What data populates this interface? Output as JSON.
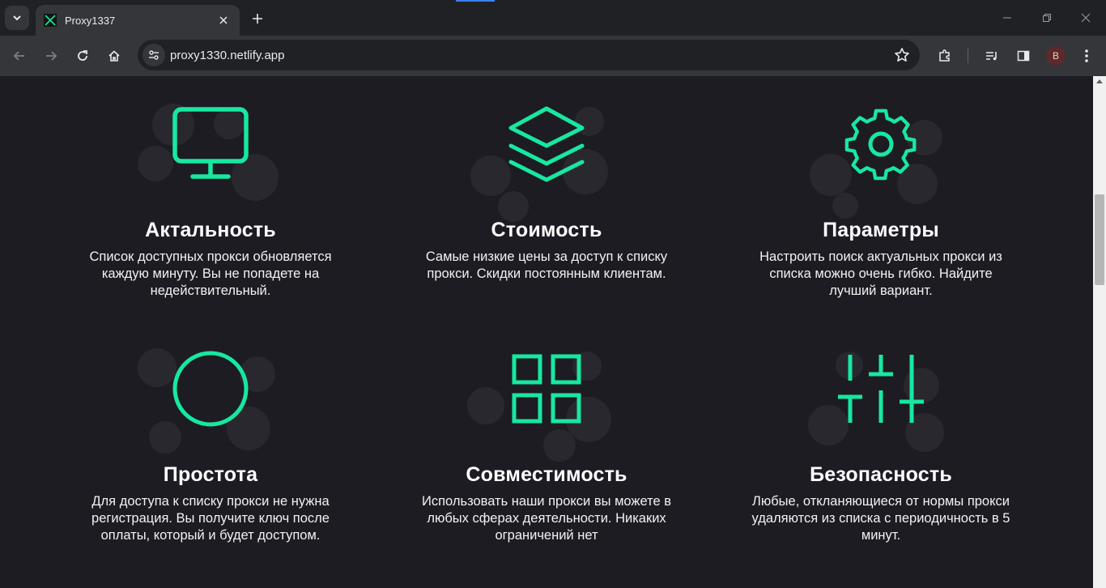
{
  "browser": {
    "tab_title": "Proxy1337",
    "url": "proxy1330.netlify.app",
    "profile_initial": "B"
  },
  "colors": {
    "accent": "#17e8a0",
    "page_bg": "#1d1c23"
  },
  "features": [
    {
      "icon": "monitor-icon",
      "title": "Актальность",
      "desc": "Список доступных прокси обновляется каждую минуту. Вы не попадете на недействительный."
    },
    {
      "icon": "layers-icon",
      "title": "Стоимость",
      "desc": "Самые низкие цены за доступ к списку прокси. Скидки постоянным клиентам."
    },
    {
      "icon": "gear-icon",
      "title": "Параметры",
      "desc": "Настроить поиск актуальных прокси из списка можно очень гибко. Найдите лучший вариант."
    },
    {
      "icon": "circle-icon",
      "title": "Простота",
      "desc": "Для доступа к списку прокси не нужна регистрация. Вы получите ключ после оплаты, который и будет доступом."
    },
    {
      "icon": "grid-icon",
      "title": "Совместимость",
      "desc": "Использовать наши прокси вы можете в любых сферах деятельности. Никаких ограничений нет"
    },
    {
      "icon": "sliders-icon",
      "title": "Безопасность",
      "desc": "Любые, откланяющиеся от нормы прокси удаляются из списка с периодичность в 5 минут."
    }
  ]
}
